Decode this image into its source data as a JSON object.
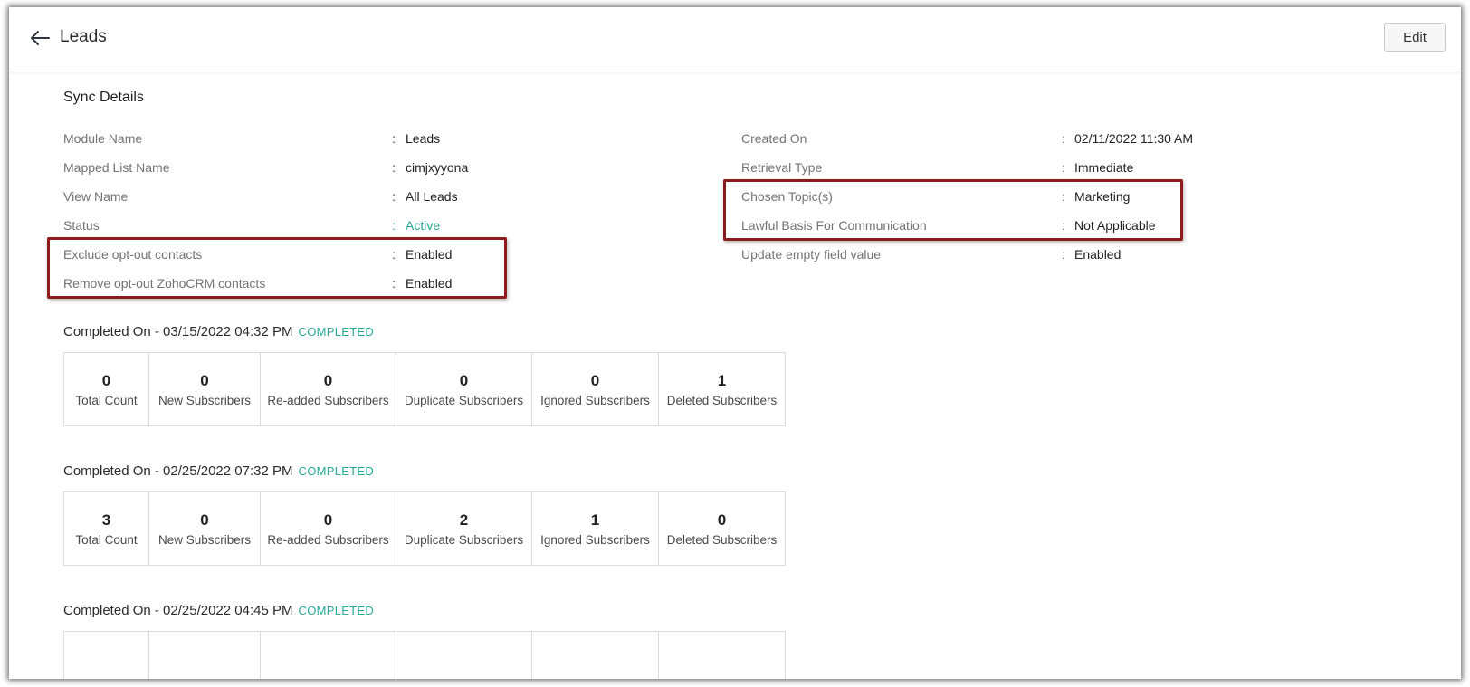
{
  "header": {
    "title": "Leads",
    "edit_label": "Edit",
    "back_icon": "arrow-left-icon"
  },
  "sync": {
    "title": "Sync Details",
    "left": [
      {
        "label": "Module Name",
        "value": "Leads"
      },
      {
        "label": "Mapped List Name",
        "value": "cimjxyyona"
      },
      {
        "label": "View Name",
        "value": "All Leads"
      },
      {
        "label": "Status",
        "value": "Active"
      },
      {
        "label": "Exclude opt-out contacts",
        "value": "Enabled"
      },
      {
        "label": "Remove opt-out ZohoCRM contacts",
        "value": "Enabled"
      }
    ],
    "right": [
      {
        "label": "Created On",
        "value": "02/11/2022 11:30 AM"
      },
      {
        "label": "Retrieval Type",
        "value": "Immediate"
      },
      {
        "label": "Chosen Topic(s)",
        "value": "Marketing"
      },
      {
        "label": "Lawful Basis For Communication",
        "value": "Not Applicable"
      },
      {
        "label": "Update empty field value",
        "value": "Enabled"
      }
    ],
    "colon": ":",
    "status_color": "#25a38f",
    "highlight_color": "#8c1b1b"
  },
  "runs": [
    {
      "completed": "Completed On - 03/15/2022 04:32 PM",
      "status": "COMPLETED",
      "stats": [
        {
          "value": "0",
          "label": "Total Count"
        },
        {
          "value": "0",
          "label": "New Subscribers"
        },
        {
          "value": "0",
          "label": "Re-added Subscribers"
        },
        {
          "value": "0",
          "label": "Duplicate Subscribers"
        },
        {
          "value": "0",
          "label": "Ignored Subscribers"
        },
        {
          "value": "1",
          "label": "Deleted Subscribers"
        }
      ]
    },
    {
      "completed": "Completed On - 02/25/2022 07:32 PM",
      "status": "COMPLETED",
      "stats": [
        {
          "value": "3",
          "label": "Total Count"
        },
        {
          "value": "0",
          "label": "New Subscribers"
        },
        {
          "value": "0",
          "label": "Re-added Subscribers"
        },
        {
          "value": "2",
          "label": "Duplicate Subscribers"
        },
        {
          "value": "1",
          "label": "Ignored Subscribers"
        },
        {
          "value": "0",
          "label": "Deleted Subscribers"
        }
      ]
    },
    {
      "completed": "Completed On - 02/25/2022 04:45 PM",
      "status": "COMPLETED"
    }
  ]
}
